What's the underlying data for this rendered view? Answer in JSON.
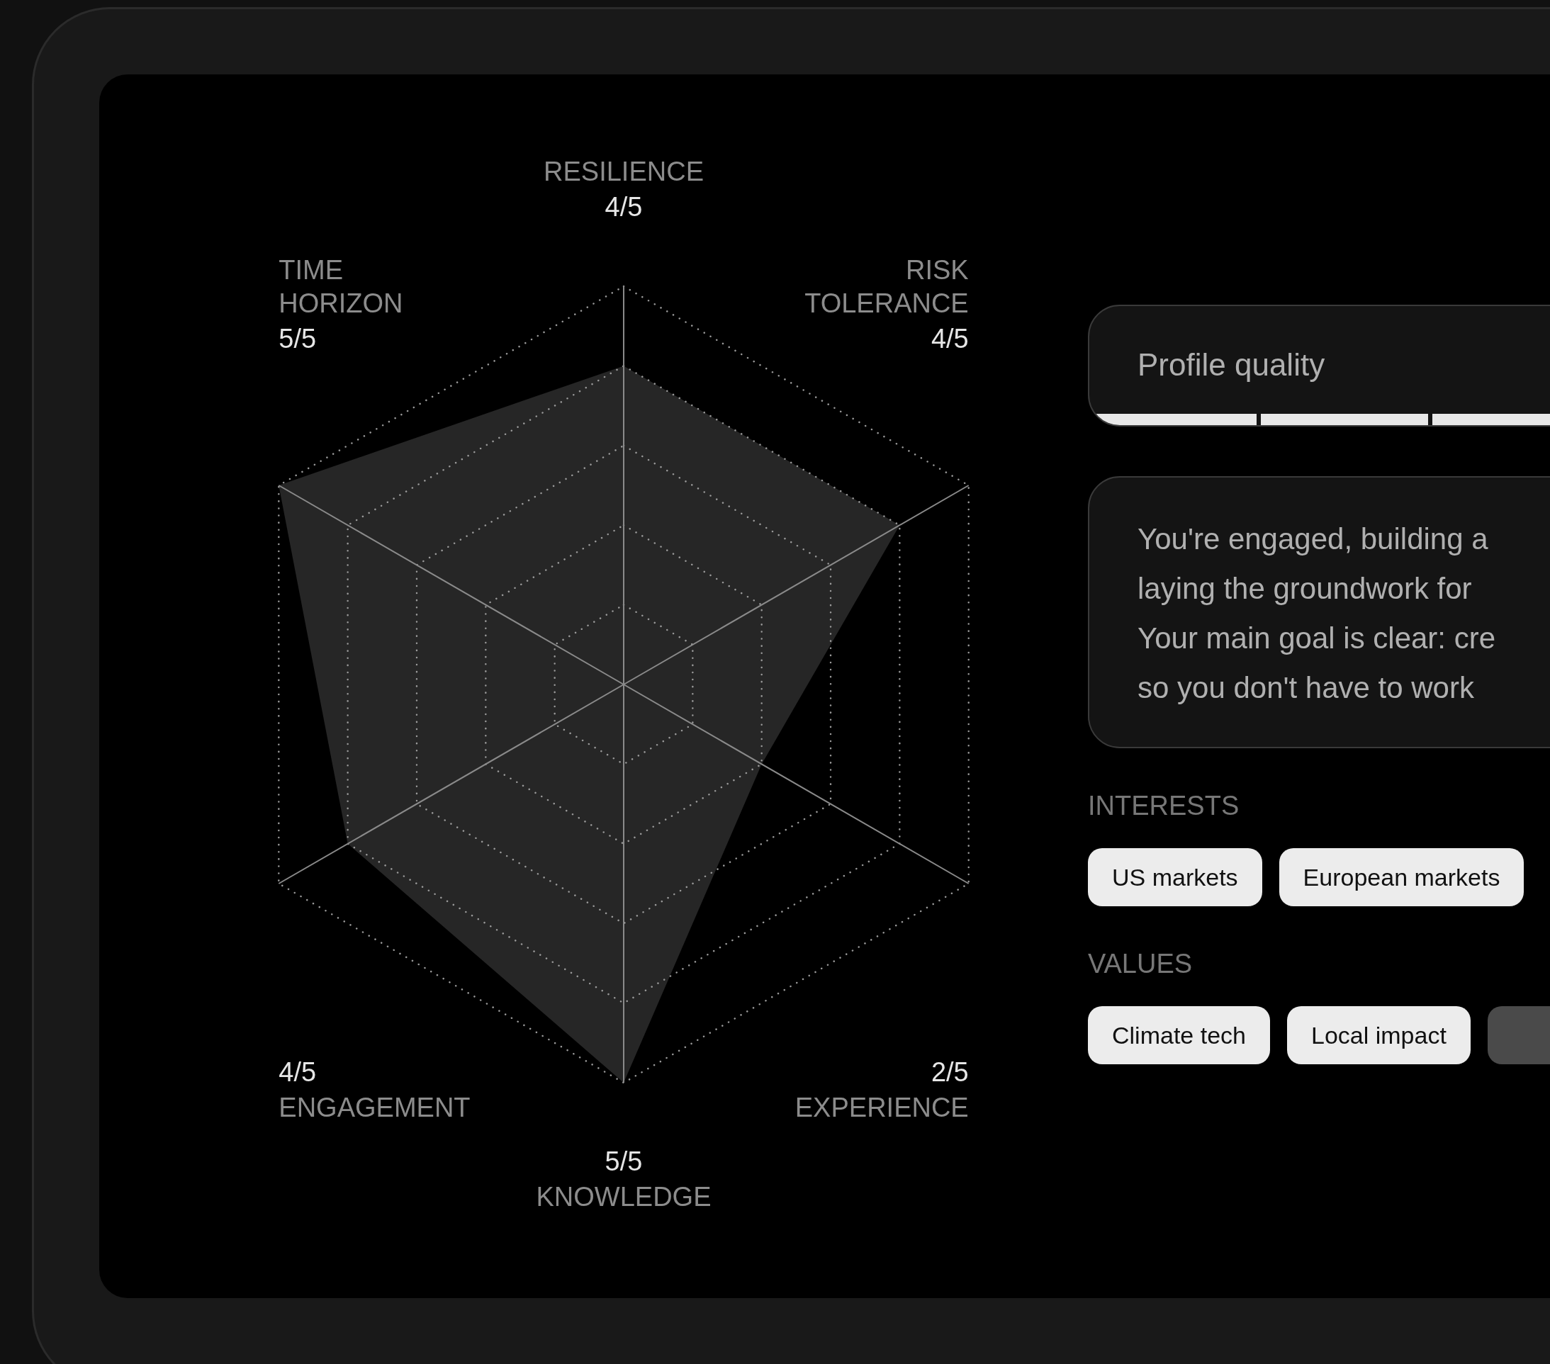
{
  "radar": {
    "axes": [
      {
        "label": "RESILIENCE",
        "score": "4/5"
      },
      {
        "label": "TIME HORIZON",
        "score": "5/5"
      },
      {
        "label": "RISK TOLERANCE",
        "score": "4/5"
      },
      {
        "label": "ENGAGEMENT",
        "score": "4/5"
      },
      {
        "label": "EXPERIENCE",
        "score": "2/5"
      },
      {
        "label": "KNOWLEDGE",
        "score": "5/5"
      }
    ]
  },
  "profile_quality": {
    "title": "Profile quality",
    "segments": [
      {
        "filled": true
      },
      {
        "filled": true
      },
      {
        "filled": true
      }
    ]
  },
  "summary": {
    "lines": [
      "You're engaged, building a",
      "laying the groundwork for",
      "Your main goal is clear: cre",
      "so you don't have to work"
    ]
  },
  "interests": {
    "heading": "INTERESTS",
    "tags": [
      {
        "label": "US markets",
        "selected": true
      },
      {
        "label": "European markets",
        "selected": true
      }
    ]
  },
  "values": {
    "heading": "VALUES",
    "tags": [
      {
        "label": "Climate tech",
        "selected": true
      },
      {
        "label": "Local impact",
        "selected": true
      },
      {
        "selected": false
      }
    ]
  }
}
